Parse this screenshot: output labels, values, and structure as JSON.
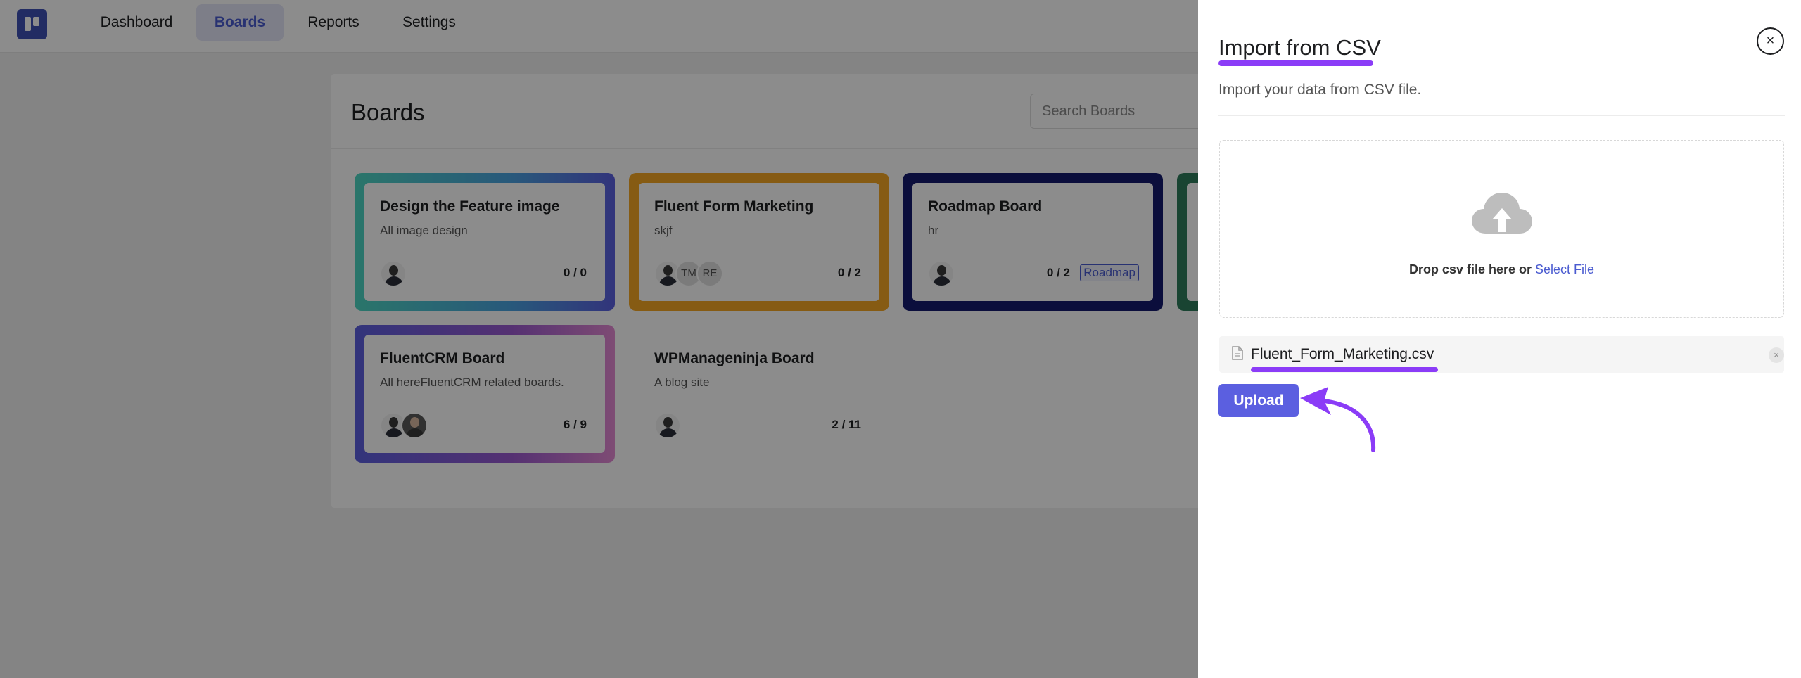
{
  "nav": {
    "items": [
      {
        "label": "Dashboard"
      },
      {
        "label": "Boards",
        "active": true
      },
      {
        "label": "Reports"
      },
      {
        "label": "Settings"
      }
    ]
  },
  "boards_page": {
    "title": "Boards",
    "search_placeholder": "Search Boards",
    "boards": [
      {
        "title": "Design the Feature image",
        "description": "All image design",
        "count": "0 / 0",
        "avatars": [
          "photo"
        ]
      },
      {
        "title": "Fluent Form Marketing",
        "description": "skjf",
        "count": "0 / 2",
        "avatars": [
          "photo",
          "TM",
          "RE"
        ]
      },
      {
        "title": "Roadmap Board",
        "description": "hr",
        "count": "0 / 2",
        "tag": "Roadmap",
        "avatars": [
          "photo"
        ]
      },
      {
        "title": "FluentCRM Board",
        "description": "All hereFluentCRM related boards.",
        "count": "6 / 9",
        "avatars": [
          "photo",
          "photo"
        ]
      },
      {
        "title": "WPManageninja Board",
        "description": "A blog site",
        "count": "2 / 11",
        "avatars": [
          "photo"
        ]
      }
    ]
  },
  "drawer": {
    "title": "Import from CSV",
    "subtitle": "Import your data from CSV file.",
    "close_label": "×",
    "dropzone": {
      "text": "Drop csv file here or",
      "link": "Select File"
    },
    "file": {
      "name": "Fluent_Form_Marketing.csv",
      "remove_label": "×"
    },
    "upload_label": "Upload"
  },
  "colors": {
    "accent": "#5b5fe0",
    "annotation": "#8b3cf7",
    "nav_active_bg": "#e4e6f7"
  }
}
